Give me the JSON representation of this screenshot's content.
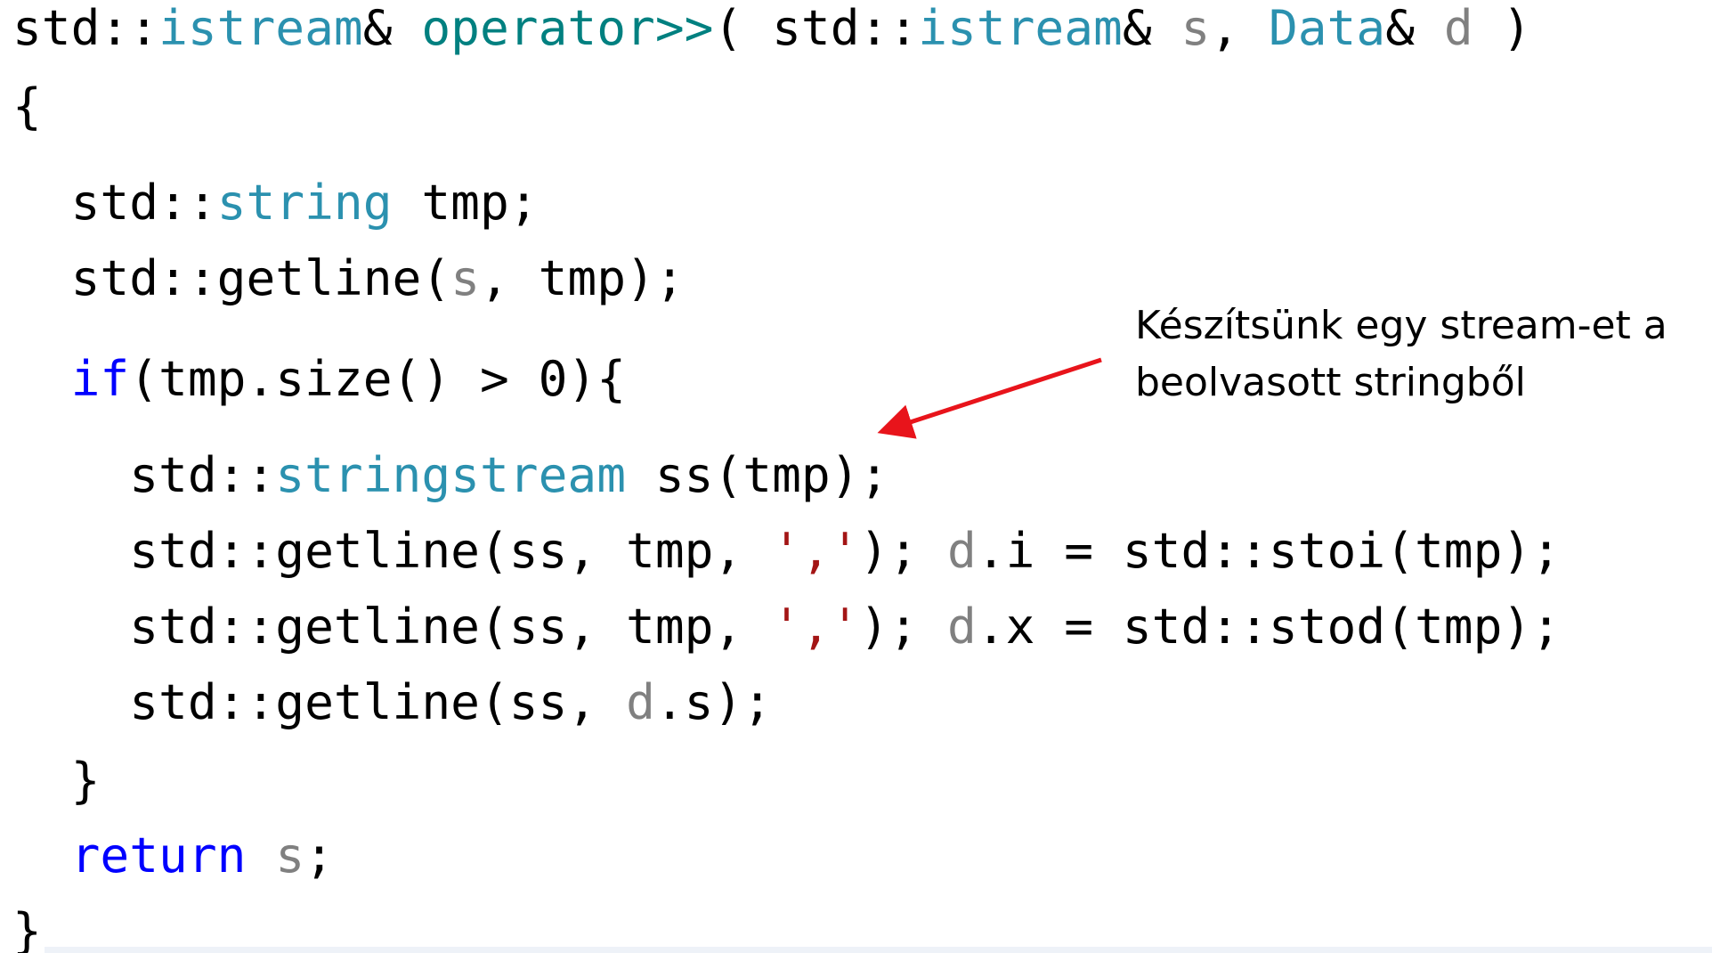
{
  "code_lines": [
    {
      "tokens": [
        {
          "text": "std::",
          "kind": "default"
        },
        {
          "text": "istream",
          "kind": "type"
        },
        {
          "text": "& ",
          "kind": "default"
        },
        {
          "text": "operator>>",
          "kind": "func"
        },
        {
          "text": "( std::",
          "kind": "default"
        },
        {
          "text": "istream",
          "kind": "type"
        },
        {
          "text": "& ",
          "kind": "default"
        },
        {
          "text": "s",
          "kind": "param"
        },
        {
          "text": ", ",
          "kind": "default"
        },
        {
          "text": "Data",
          "kind": "type"
        },
        {
          "text": "& ",
          "kind": "default"
        },
        {
          "text": "d",
          "kind": "param"
        },
        {
          "text": " )",
          "kind": "default"
        }
      ]
    },
    {
      "tokens": [
        {
          "text": "{",
          "kind": "default"
        }
      ]
    },
    {
      "tokens": [
        {
          "text": "  std::",
          "kind": "default"
        },
        {
          "text": "string",
          "kind": "type"
        },
        {
          "text": " tmp;",
          "kind": "default"
        }
      ]
    },
    {
      "tokens": [
        {
          "text": "  std::getline(",
          "kind": "default"
        },
        {
          "text": "s",
          "kind": "param"
        },
        {
          "text": ", tmp);",
          "kind": "default"
        }
      ]
    },
    {
      "tokens": [
        {
          "text": "  ",
          "kind": "default"
        },
        {
          "text": "if",
          "kind": "keyword"
        },
        {
          "text": "(tmp.size() > 0){",
          "kind": "default"
        }
      ]
    },
    {
      "tokens": [
        {
          "text": "    std::",
          "kind": "default"
        },
        {
          "text": "stringstream",
          "kind": "type"
        },
        {
          "text": " ss(tmp);",
          "kind": "default"
        }
      ]
    },
    {
      "tokens": [
        {
          "text": "    std::getline(ss, tmp, ",
          "kind": "default"
        },
        {
          "text": "','",
          "kind": "string"
        },
        {
          "text": "); ",
          "kind": "default"
        },
        {
          "text": "d",
          "kind": "param"
        },
        {
          "text": ".i = std::stoi(tmp);",
          "kind": "default"
        }
      ]
    },
    {
      "tokens": [
        {
          "text": "    std::getline(ss, tmp, ",
          "kind": "default"
        },
        {
          "text": "','",
          "kind": "string"
        },
        {
          "text": "); ",
          "kind": "default"
        },
        {
          "text": "d",
          "kind": "param"
        },
        {
          "text": ".x = std::stod(tmp);",
          "kind": "default"
        }
      ]
    },
    {
      "tokens": [
        {
          "text": "    std::getline(ss, ",
          "kind": "default"
        },
        {
          "text": "d",
          "kind": "param"
        },
        {
          "text": ".s);",
          "kind": "default"
        }
      ]
    },
    {
      "tokens": [
        {
          "text": "  }",
          "kind": "default"
        }
      ]
    },
    {
      "tokens": [
        {
          "text": "  ",
          "kind": "default"
        },
        {
          "text": "return",
          "kind": "keyword"
        },
        {
          "text": " ",
          "kind": "default"
        },
        {
          "text": "s",
          "kind": "param"
        },
        {
          "text": ";",
          "kind": "default"
        }
      ]
    },
    {
      "tokens": [
        {
          "text": "}",
          "kind": "default"
        }
      ]
    }
  ],
  "annotation": {
    "line1": "Készítsünk egy stream-et a",
    "line2": "beolvasott stringből"
  },
  "colors": {
    "default": "#000000",
    "type": "#2b91af",
    "func": "#008080",
    "param": "#808080",
    "keyword": "#0000ff",
    "string": "#a31515",
    "arrow": "#e8141b"
  }
}
